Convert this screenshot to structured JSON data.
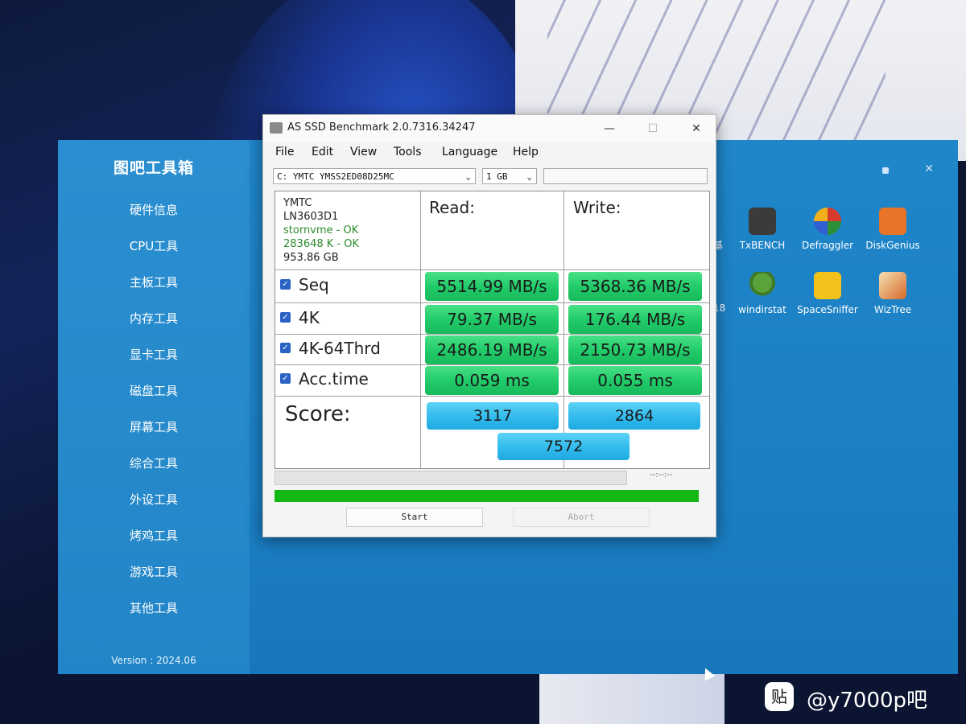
{
  "toolbox": {
    "title": "图吧工具箱",
    "menu": [
      "硬件信息",
      "CPU工具",
      "主板工具",
      "内存工具",
      "显卡工具",
      "磁盘工具",
      "屏幕工具",
      "综合工具",
      "外设工具",
      "烤鸡工具",
      "游戏工具",
      "其他工具"
    ],
    "version": "Version : 2024.06",
    "partial_label_1": "基",
    "partial_label_2": "18",
    "desktop_icons": [
      {
        "label": "TxBENCH",
        "icon": "txbench-icon",
        "color": "#3b3b3b"
      },
      {
        "label": "Defraggler",
        "icon": "defraggler-icon",
        "color": "#d63a2b"
      },
      {
        "label": "DiskGenius",
        "icon": "diskgenius-icon",
        "color": "#e8742a"
      },
      {
        "label": "windirstat",
        "icon": "tree-icon",
        "color": "#3f7a2a"
      },
      {
        "label": "SpaceSniffer",
        "icon": "puzzle-icon",
        "color": "#f2c21b"
      },
      {
        "label": "WizTree",
        "icon": "wiztree-icon",
        "color": "#d86a28"
      }
    ]
  },
  "asssd": {
    "title": "AS SSD Benchmark 2.0.7316.34247",
    "menu": [
      "File",
      "Edit",
      "View",
      "Tools",
      "Language",
      "Help"
    ],
    "drive_select": "C: YMTC YMSS2ED08D25MC",
    "size_select": "1 GB",
    "info": {
      "vendor": "YMTC",
      "firmware": "LN3603D1",
      "driver": "stornvme - OK",
      "alignment": "283648 K - OK",
      "capacity": "953.86 GB"
    },
    "headers": {
      "read": "Read:",
      "write": "Write:"
    },
    "rows": [
      {
        "label": "Seq",
        "read": "5514.99 MB/s",
        "write": "5368.36 MB/s"
      },
      {
        "label": "4K",
        "read": "79.37 MB/s",
        "write": "176.44 MB/s"
      },
      {
        "label": "4K-64Thrd",
        "read": "2486.19 MB/s",
        "write": "2150.73 MB/s"
      },
      {
        "label": "Acc.time",
        "read": "0.059 ms",
        "write": "0.055 ms"
      }
    ],
    "score_label": "Score:",
    "score_read": "3117",
    "score_write": "2864",
    "score_total": "7572",
    "elapsed": "--:--:--",
    "progress": 1.0,
    "start_label": "Start",
    "abort_label": "Abort"
  },
  "watermark": {
    "icon_glyph": "贴",
    "text": "@y7000p吧"
  }
}
